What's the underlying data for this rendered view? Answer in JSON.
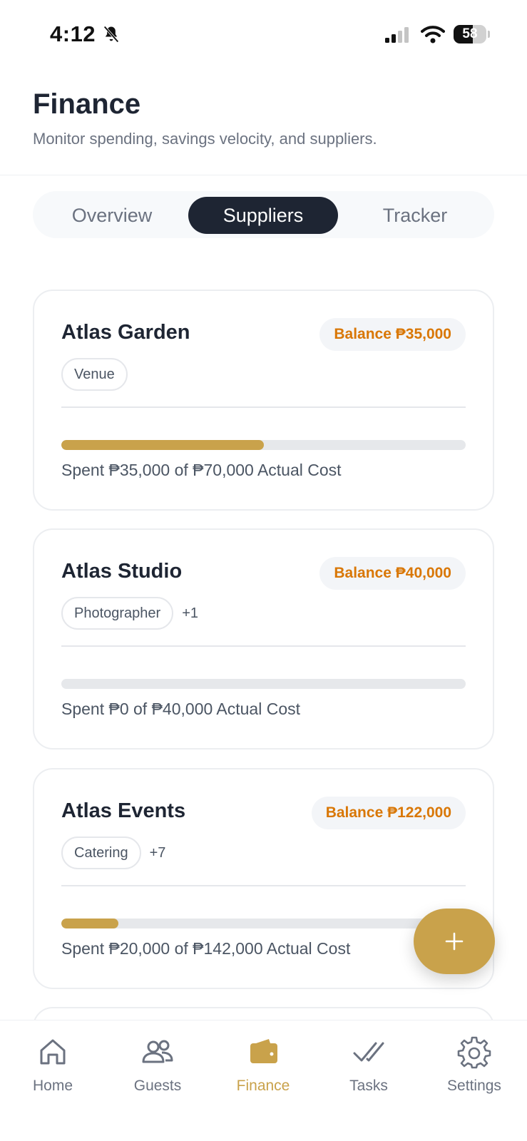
{
  "status_bar": {
    "time": "4:12",
    "battery": "58"
  },
  "header": {
    "title": "Finance",
    "subtitle": "Monitor spending, savings velocity, and suppliers."
  },
  "tabs": [
    {
      "label": "Overview",
      "active": false
    },
    {
      "label": "Suppliers",
      "active": true
    },
    {
      "label": "Tracker",
      "active": false
    }
  ],
  "suppliers": [
    {
      "name": "Atlas Garden",
      "balance": "Balance ₱35,000",
      "tag": "Venue",
      "extra_tags": "",
      "progress": 0.5,
      "spent_text": "Spent ₱35,000 of ₱70,000 Actual Cost"
    },
    {
      "name": "Atlas Studio",
      "balance": "Balance ₱40,000",
      "tag": "Photographer",
      "extra_tags": "+1",
      "progress": 0.0,
      "spent_text": "Spent ₱0 of ₱40,000 Actual Cost"
    },
    {
      "name": "Atlas Events",
      "balance": "Balance ₱122,000",
      "tag": "Catering",
      "extra_tags": "+7",
      "progress": 0.1408,
      "spent_text": "Spent ₱20,000 of ₱142,000 Actual Cost"
    }
  ],
  "fab": {
    "icon": "plus-icon"
  },
  "colors": {
    "accent": "#c9a24b",
    "balance": "#d97706",
    "dark": "#1e2533"
  },
  "bottom_nav": [
    {
      "label": "Home",
      "icon": "home-icon",
      "active": false
    },
    {
      "label": "Guests",
      "icon": "guests-icon",
      "active": false
    },
    {
      "label": "Finance",
      "icon": "wallet-icon",
      "active": true
    },
    {
      "label": "Tasks",
      "icon": "double-check-icon",
      "active": false
    },
    {
      "label": "Settings",
      "icon": "gear-icon",
      "active": false
    }
  ]
}
